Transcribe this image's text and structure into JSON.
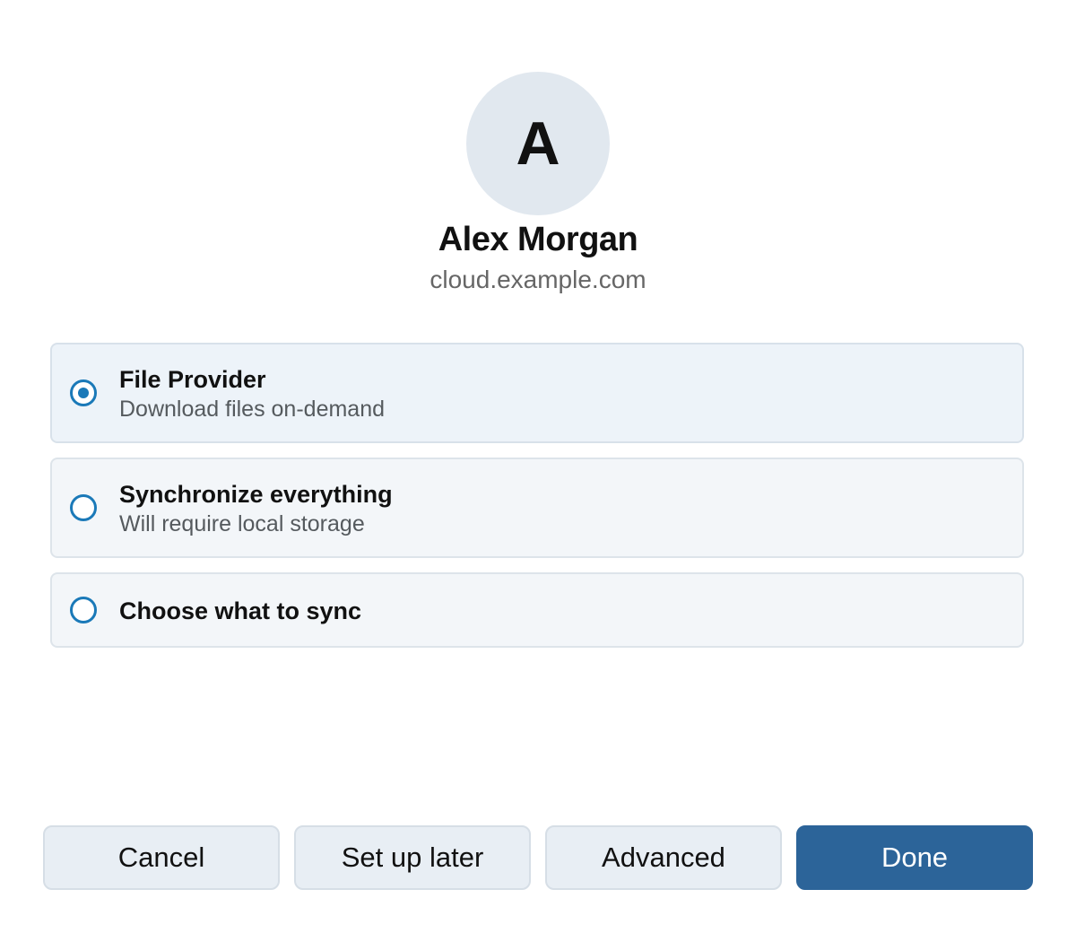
{
  "account": {
    "avatar_initial": "A",
    "name": "Alex Morgan",
    "server": "cloud.example.com"
  },
  "sync_options": [
    {
      "title": "File Provider",
      "subtitle": "Download files on-demand",
      "selected": true
    },
    {
      "title": "Synchronize everything",
      "subtitle": "Will require local storage",
      "selected": false
    },
    {
      "title": "Choose what to sync",
      "subtitle": "",
      "selected": false
    }
  ],
  "buttons": {
    "cancel": "Cancel",
    "setup_later": "Set up later",
    "advanced": "Advanced",
    "done": "Done"
  },
  "colors": {
    "accent": "#1a79b8",
    "primary_button": "#2c6499",
    "avatar_bg": "#e1e8ef",
    "option_bg": "#f3f6f9",
    "option_selected_bg": "#edf3f9"
  }
}
